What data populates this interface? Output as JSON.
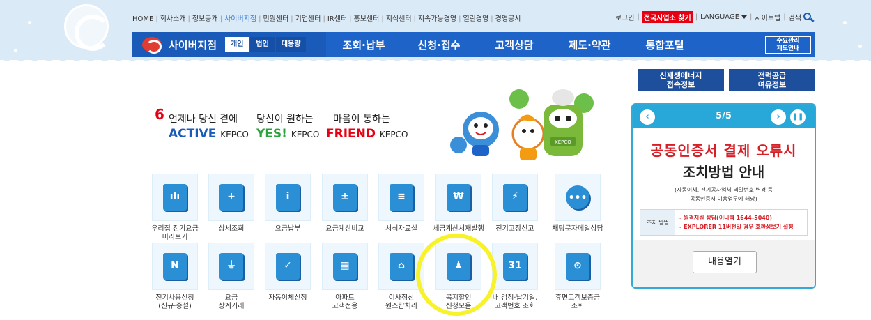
{
  "util_nav": {
    "items": [
      "HOME",
      "회사소개",
      "정보공개",
      "사이버지점",
      "민원센터",
      "기업센터",
      "IR센터",
      "홍보센터",
      "지식센터",
      "지속가능경영",
      "열린경영",
      "경영공시"
    ],
    "active_index": 3,
    "login": "로그인",
    "find_office": "전국사업소 찾기",
    "language": "LANGUAGE",
    "sitemap": "사이트맵",
    "search": "검색"
  },
  "navbar": {
    "brand": "사이버지점",
    "segments": [
      "개인",
      "법인",
      "대용량"
    ],
    "menu": [
      "조회·납부",
      "신청·접수",
      "고객상담",
      "제도·약관",
      "통합포털"
    ],
    "demand_line1": "수요관리",
    "demand_line2": "제도안내"
  },
  "side_buttons": [
    {
      "line1": "신재생에너지",
      "line2": "접속정보"
    },
    {
      "line1": "전력공급",
      "line2": "여유정보"
    }
  ],
  "slogan": {
    "mark": "6",
    "cols": [
      {
        "kr": "언제나 당신 곁에",
        "en": "ACTIVE",
        "brand": "KEPCO",
        "color": "#1a5ab8"
      },
      {
        "kr": "당신이 원하는",
        "en": "YES!",
        "brand": "KEPCO",
        "color": "#2aa33a"
      },
      {
        "kr": "마음이 통하는",
        "en": "FRIEND",
        "brand": "KEPCO",
        "color": "#e60012"
      }
    ]
  },
  "mascot_badge": "KEPCO",
  "services_row1": [
    {
      "l1": "우리집 전기요금",
      "l2": "미리보기",
      "glyph": "ılı",
      "icon": "house-bill-icon"
    },
    {
      "l1": "상세조회",
      "l2": "",
      "glyph": "+",
      "icon": "detail-search-icon"
    },
    {
      "l1": "요금납부",
      "l2": "",
      "glyph": "i",
      "icon": "payment-icon"
    },
    {
      "l1": "요금계산비교",
      "l2": "",
      "glyph": "±",
      "icon": "calculator-icon"
    },
    {
      "l1": "서식자료실",
      "l2": "",
      "glyph": "≡",
      "icon": "form-library-icon"
    },
    {
      "l1": "세금계산서재발행",
      "l2": "",
      "glyph": "₩",
      "icon": "tax-invoice-icon"
    },
    {
      "l1": "전기고장신고",
      "l2": "",
      "glyph": "⚡",
      "icon": "fault-report-icon"
    },
    {
      "l1": "채팅문자메일상담",
      "l2": "",
      "glyph": "•••",
      "icon": "chat-icon"
    }
  ],
  "services_row2": [
    {
      "l1": "전기사용신청",
      "l2": "(신규·증설)",
      "glyph": "N",
      "icon": "new-service-icon"
    },
    {
      "l1": "요금",
      "l2": "상계거래",
      "glyph": "⏚",
      "icon": "plug-icon"
    },
    {
      "l1": "자동이체신청",
      "l2": "",
      "glyph": "✓",
      "icon": "auto-transfer-icon"
    },
    {
      "l1": "아파트",
      "l2": "고객전용",
      "glyph": "▦",
      "icon": "apartment-icon"
    },
    {
      "l1": "이사정산",
      "l2": "원스탑처리",
      "glyph": "⌂",
      "icon": "moving-icon"
    },
    {
      "l1": "복지할인",
      "l2": "신청모음",
      "glyph": "♟",
      "icon": "welfare-discount-icon"
    },
    {
      "l1": "내 검침·납기일,",
      "l2": "고객번호 조회",
      "glyph": "31",
      "icon": "calendar-icon"
    },
    {
      "l1": "휴면고객보증금",
      "l2": "조회",
      "glyph": "⊙",
      "icon": "deposit-icon"
    }
  ],
  "notice": {
    "page": "5/5",
    "title_red": "공동인증서 결제 오류시",
    "title": "조치방법 안내",
    "sub1": "(자동이체, 전기공사업체 비밀번호 변경 등",
    "sub2": "공동인증서 이용업무에 해당)",
    "method_label": "조치 방법",
    "method_1": "- 원격지원 상담(이니텍 1644-5040)",
    "method_2": "- EXPLORER 11버전일 경우 호환성보기 설정",
    "open_button": "내용열기"
  },
  "colors": {
    "sky": "#dbeaf7",
    "nav": "#1e64c8",
    "accent_red": "#e60012",
    "panel": "#27a8d8",
    "highlight": "#f7f22a"
  }
}
